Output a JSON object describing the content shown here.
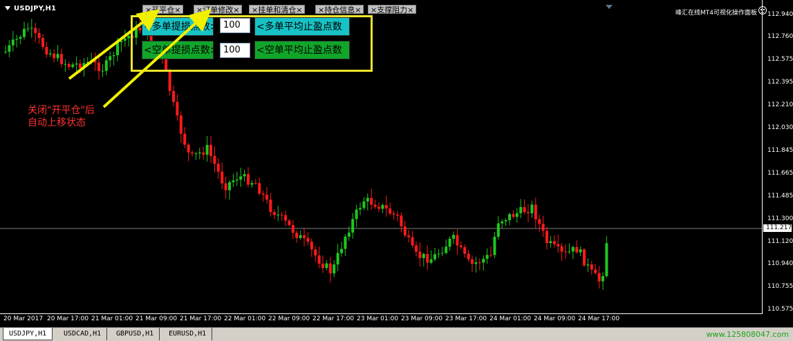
{
  "chart": {
    "symbol_title": "USDJPY,H1",
    "panel_title": "峰汇在线MT4可视化操作面板",
    "current_price": "111.217",
    "price_labels": [
      "112.940",
      "112.760",
      "112.575",
      "112.395",
      "112.210",
      "112.030",
      "111.845",
      "111.665",
      "111.485",
      "111.300",
      "111.120",
      "110.940",
      "110.755",
      "110.575"
    ],
    "time_labels": [
      "20 Mar 2017",
      "20 Mar 17:00",
      "21 Mar 01:00",
      "21 Mar 09:00",
      "21 Mar 17:00",
      "22 Mar 01:00",
      "22 Mar 09:00",
      "22 Mar 17:00",
      "23 Mar 01:00",
      "23 Mar 09:00",
      "23 Mar 17:00",
      "24 Mar 01:00",
      "24 Mar 09:00",
      "24 Mar 17:00"
    ],
    "colors": {
      "bull": "#1ec81e",
      "bear": "#ff1a1a",
      "grid": "#808080",
      "highlight": "#f0e52a"
    }
  },
  "tabs": [
    "×开平仓×",
    "×订单修改×",
    "×挂单和清仓×",
    "×持仓信息×",
    "×支撑阻力×"
  ],
  "panel": {
    "buy_sl_button": "<多单提损点数>",
    "buy_sl_value": "100",
    "buy_tp_button": "<多单平均止盈点数",
    "sell_sl_button": "<空单提损点数>",
    "sell_sl_value": "100",
    "sell_tp_button": "<空单平均止盈点数"
  },
  "annotation": "关闭\"开平仓\"后\n自动上移状态",
  "symbol_tabs": [
    "USDJPY,H1",
    "USDCAD,H1",
    "GBPUSD,H1",
    "EURUSD,H1"
  ],
  "watermark": "www.125808047.com"
}
